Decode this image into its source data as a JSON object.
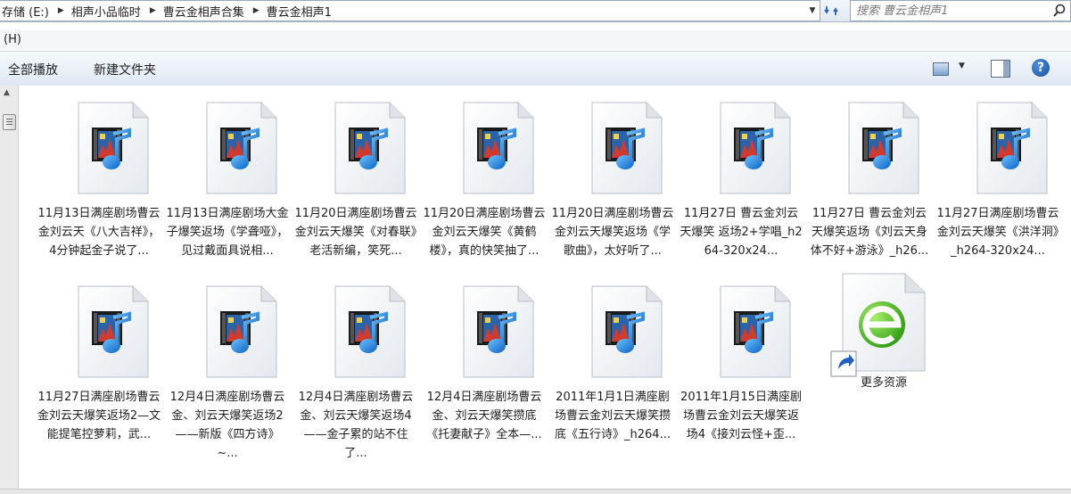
{
  "address": {
    "crumbs": [
      "存储 (E:)",
      "相声小品临时",
      "曹云金相声合集",
      "曹云金相声1"
    ]
  },
  "search": {
    "placeholder": "搜索 曹云金相声1"
  },
  "menu": {
    "label": "(H)"
  },
  "toolbar": {
    "play_all": "全部播放",
    "new_folder": "新建文件夹"
  },
  "files": [
    {
      "label": "11月13日满座剧场曹云金刘云天《八大吉祥》，4分钟起金子说了...",
      "icon": "media-file-icon"
    },
    {
      "label": "11月13日满座剧场大金子爆笑返场《学聋哑》，见过戴面具说相...",
      "icon": "media-file-icon"
    },
    {
      "label": "11月20日满座剧场曹云金刘云天爆笑《对春联》老活新编，笑死...",
      "icon": "media-file-icon"
    },
    {
      "label": "11月20日满座剧场曹云金刘云天爆笑《黄鹤楼》，真的快笑抽了...",
      "icon": "media-file-icon"
    },
    {
      "label": "11月20日满座剧场曹云金刘云天爆笑返场《学歌曲》，太好听了...",
      "icon": "media-file-icon"
    },
    {
      "label": "11月27日 曹云金刘云天爆笑 返场2+学唱_h264-320x24...",
      "icon": "media-file-icon"
    },
    {
      "label": "11月27日 曹云金刘云天爆笑返场《刘云天身体不好+游泳》_h26...",
      "icon": "media-file-icon"
    },
    {
      "label": "11月27日满座剧场曹云金刘云天爆笑《洪洋洞》_h264-320x24...",
      "icon": "media-file-icon"
    },
    {
      "label": "11月27日满座剧场曹云金刘云天爆笑返场2—文能提笔控萝莉，武...",
      "icon": "media-file-icon"
    },
    {
      "label": "12月4日满座剧场曹云金、刘云天爆笑返场2——新版《四方诗》~...",
      "icon": "media-file-icon"
    },
    {
      "label": "12月4日满座剧场曹云金、刘云天爆笑返场4——金子累的站不住了...",
      "icon": "media-file-icon"
    },
    {
      "label": "12月4日满座剧场曹云金、刘云天爆笑攒底《托妻献子》全本—...",
      "icon": "media-file-icon"
    },
    {
      "label": "2011年1月1日满座剧场曹云金刘云天爆笑攒底《五行诗》_h264...",
      "icon": "media-file-icon"
    },
    {
      "label": "2011年1月15日满座剧场曹云金刘云天爆笑返场4《接刘云怪+歪...",
      "icon": "media-file-icon"
    },
    {
      "label": "更多资源",
      "icon": "ie-shortcut-icon"
    }
  ]
}
